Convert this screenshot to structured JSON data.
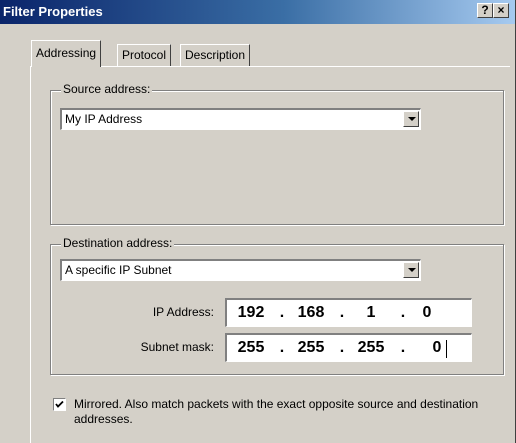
{
  "window": {
    "title": "Filter Properties",
    "help_button": "?",
    "close_button": "x"
  },
  "tabs": [
    {
      "label": "Addressing",
      "active": true
    },
    {
      "label": "Protocol",
      "active": false
    },
    {
      "label": "Description",
      "active": false
    }
  ],
  "source": {
    "group_label": "Source address:",
    "selected": "My IP Address"
  },
  "destination": {
    "group_label": "Destination address:",
    "selected": "A specific IP Subnet",
    "ip_label": "IP Address:",
    "ip": [
      "192",
      "168",
      "1",
      "0"
    ],
    "mask_label": "Subnet mask:",
    "mask": [
      "255",
      "255",
      "255",
      "0"
    ]
  },
  "mirrored": {
    "checked": true,
    "label": "Mirrored. Also match packets with the exact opposite source and destination addresses."
  }
}
